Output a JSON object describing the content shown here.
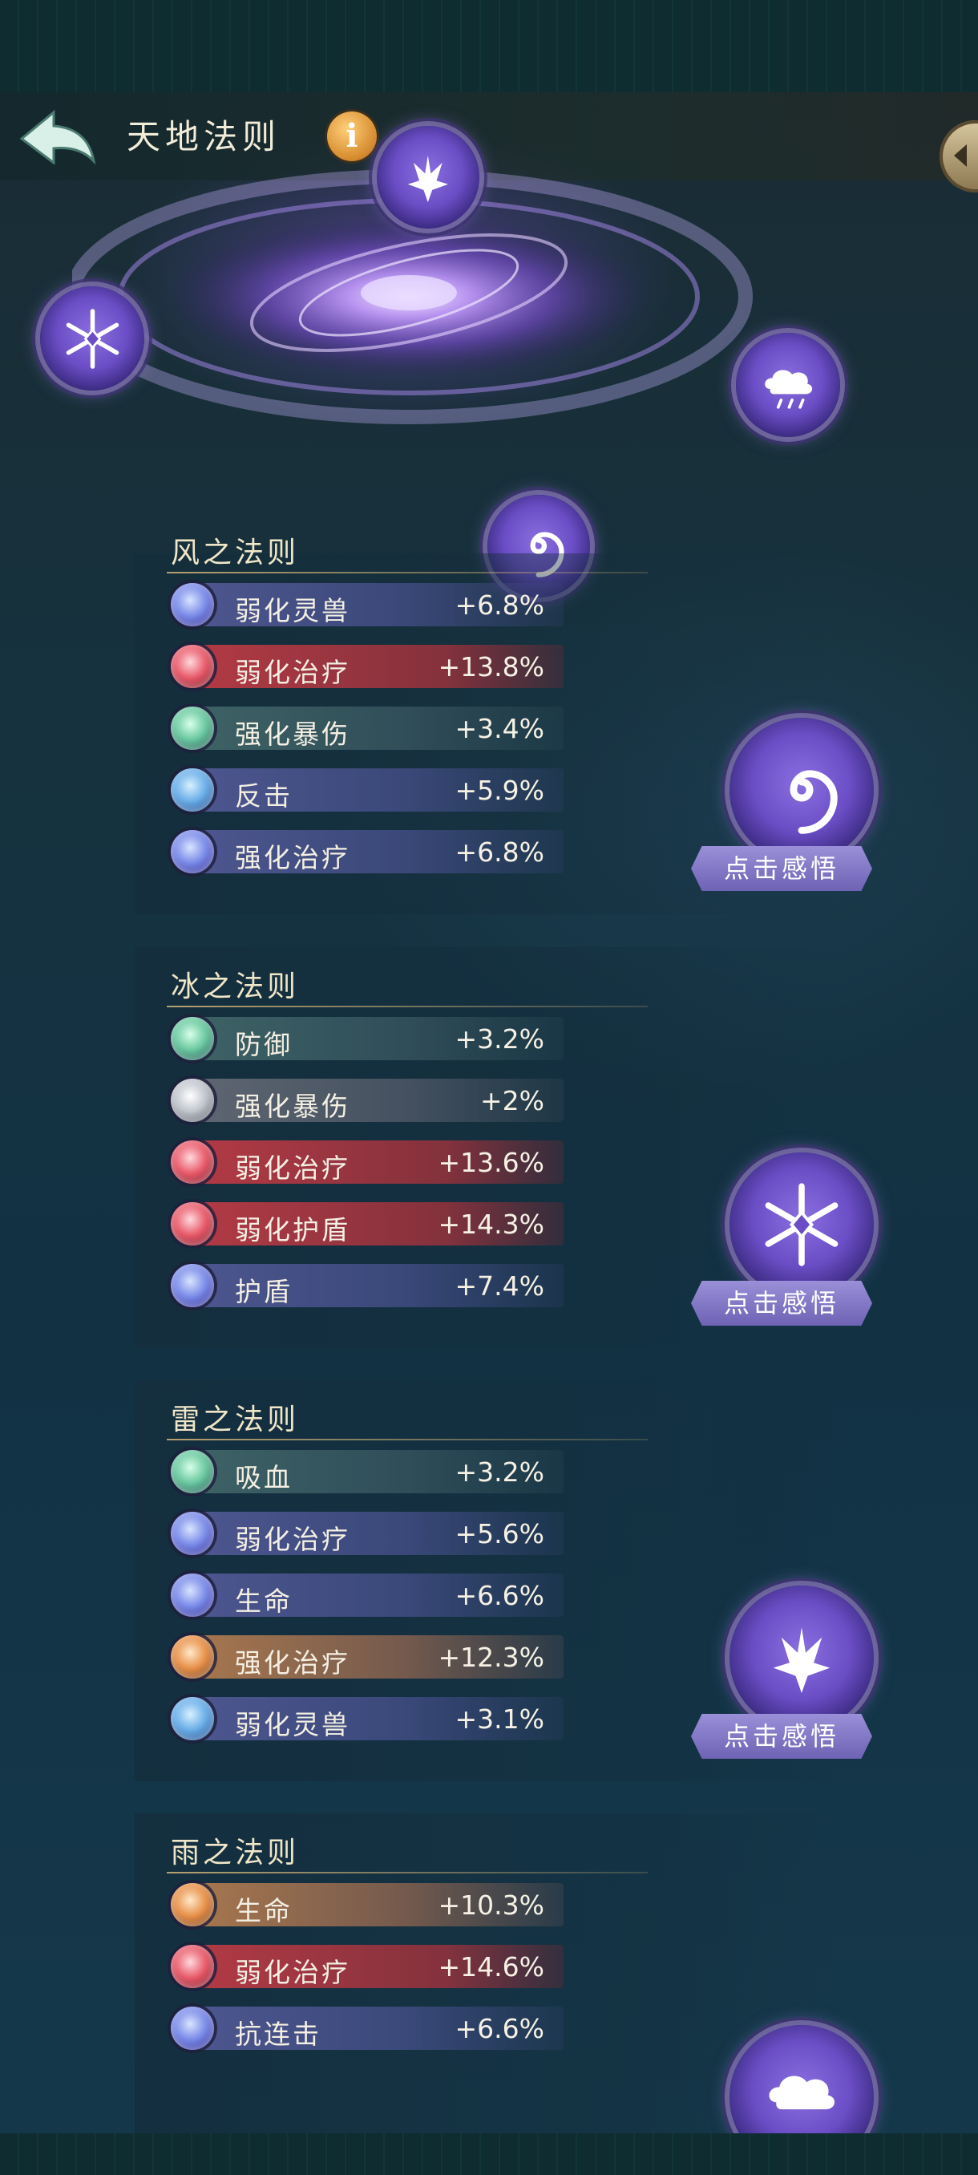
{
  "header": {
    "title": "天地法则",
    "info_label": "i"
  },
  "galaxy": {
    "orbs": [
      {
        "name": "thunder",
        "icon": "thunder-icon"
      },
      {
        "name": "ice",
        "icon": "snowflake-icon"
      },
      {
        "name": "rain",
        "icon": "cloud-rain-icon"
      },
      {
        "name": "wind",
        "icon": "swirl-icon"
      }
    ]
  },
  "laws": [
    {
      "title": "风之法则",
      "button": "点击感悟",
      "icon": "swirl-icon",
      "stats": [
        {
          "name": "弱化灵兽",
          "value": "+6.8%",
          "color": "blue"
        },
        {
          "name": "弱化治疗",
          "value": "+13.8%",
          "color": "red"
        },
        {
          "name": "强化暴伤",
          "value": "+3.4%",
          "color": "teal"
        },
        {
          "name": "反击",
          "value": "+5.9%",
          "color": "blue"
        },
        {
          "name": "强化治疗",
          "value": "+6.8%",
          "color": "blue"
        }
      ]
    },
    {
      "title": "冰之法则",
      "button": "点击感悟",
      "icon": "snowflake-icon",
      "stats": [
        {
          "name": "防御",
          "value": "+3.2%",
          "color": "teal"
        },
        {
          "name": "强化暴伤",
          "value": "+2%",
          "color": "gray"
        },
        {
          "name": "弱化治疗",
          "value": "+13.6%",
          "color": "red"
        },
        {
          "name": "弱化护盾",
          "value": "+14.3%",
          "color": "red"
        },
        {
          "name": "护盾",
          "value": "+7.4%",
          "color": "blue"
        }
      ]
    },
    {
      "title": "雷之法则",
      "button": "点击感悟",
      "icon": "thunder-icon",
      "stats": [
        {
          "name": "吸血",
          "value": "+3.2%",
          "color": "teal"
        },
        {
          "name": "弱化治疗",
          "value": "+5.6%",
          "color": "blue"
        },
        {
          "name": "生命",
          "value": "+6.6%",
          "color": "blue"
        },
        {
          "name": "强化治疗",
          "value": "+12.3%",
          "color": "orange"
        },
        {
          "name": "弱化灵兽",
          "value": "+3.1%",
          "color": "sky"
        }
      ]
    },
    {
      "title": "雨之法则",
      "button": "",
      "icon": "cloud-rain-icon",
      "stats": [
        {
          "name": "生命",
          "value": "+10.3%",
          "color": "orange"
        },
        {
          "name": "弱化治疗",
          "value": "+14.6%",
          "color": "red"
        },
        {
          "name": "抗连击",
          "value": "+6.6%",
          "color": "blue"
        }
      ]
    }
  ]
}
